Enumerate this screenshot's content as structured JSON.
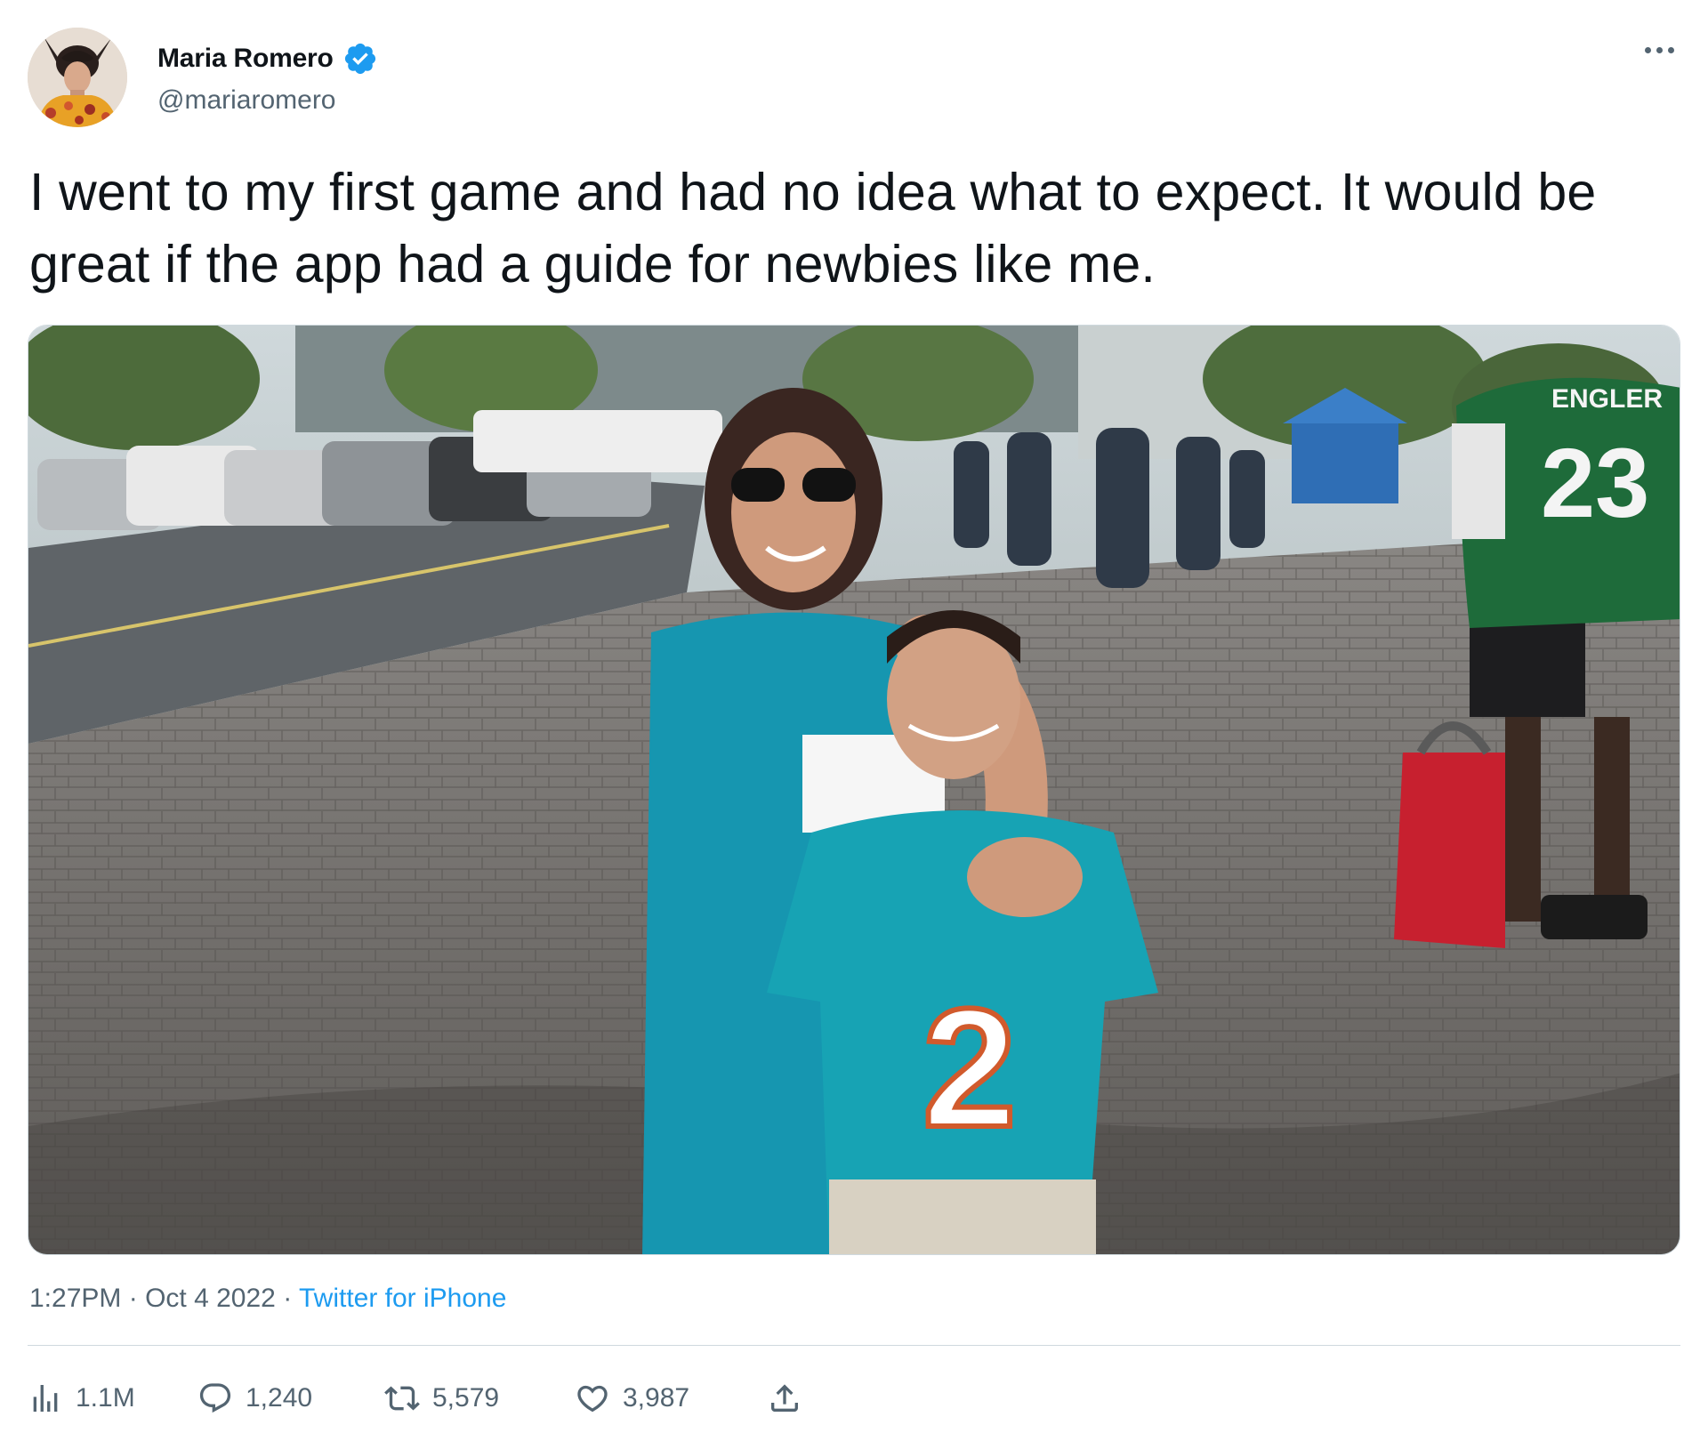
{
  "author": {
    "display_name": "Maria Romero",
    "handle": "@mariaromero",
    "verified": true
  },
  "tweet": {
    "text": "I went to my first game and had no idea what to expect. It would be great if the app had a guide for newbies like me.",
    "time": "1:27PM",
    "date": "Oct 4 2022",
    "separator": "·",
    "source": "Twitter for iPhone"
  },
  "photo": {
    "jersey_numbers": [
      "2",
      "23"
    ],
    "jersey_name": "ENGLER"
  },
  "stats": {
    "views": "1.1M",
    "replies": "1,240",
    "retweets": "5,579",
    "likes": "3,987"
  },
  "icons": {
    "more": "more-options-icon",
    "verified": "verified-badge-icon",
    "views": "views-chart-icon",
    "reply": "reply-bubble-icon",
    "retweet": "retweet-icon",
    "like": "heart-icon",
    "share": "share-icon"
  },
  "colors": {
    "text_primary": "#0f1419",
    "text_secondary": "#536471",
    "accent": "#1d9bf0",
    "divider": "#cfd9de"
  }
}
